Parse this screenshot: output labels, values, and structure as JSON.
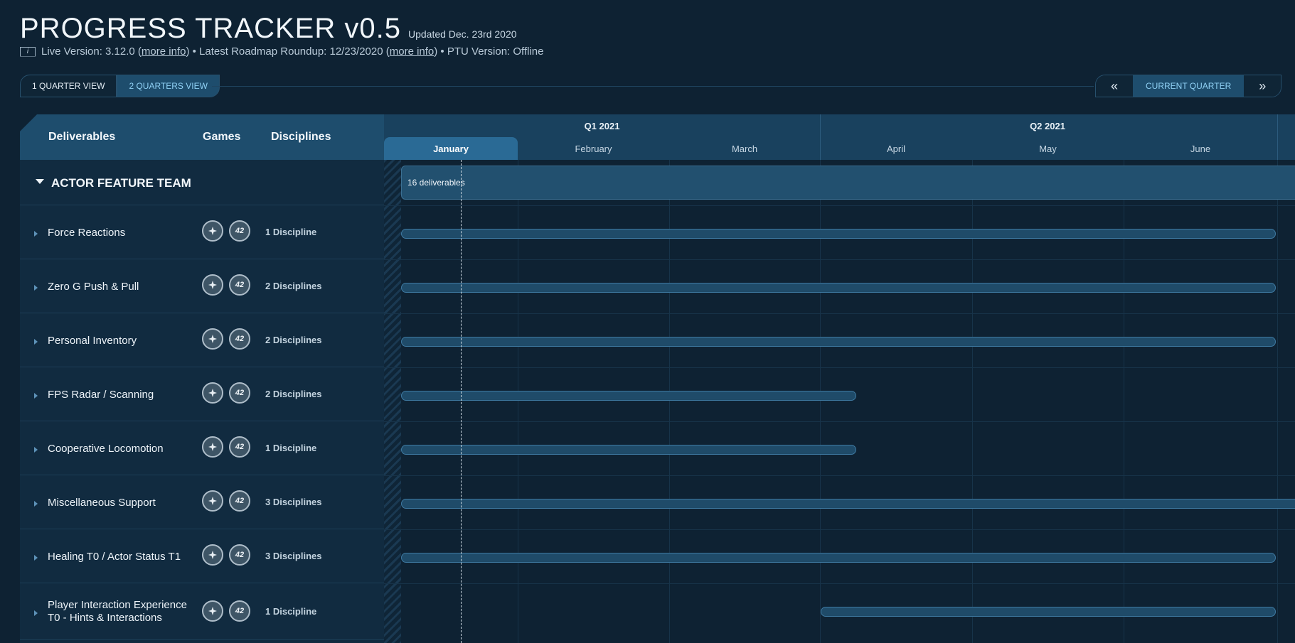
{
  "header": {
    "title": "PROGRESS TRACKER v0.5",
    "updated": "Updated Dec. 23rd 2020",
    "info_icon": "i",
    "live_version": "Live Version: 3.12.0 (",
    "more_info_1": "more info",
    "roadmap": ") • Latest Roadmap Roundup: 12/23/2020 (",
    "more_info_2": "more info",
    "ptu": ") • PTU Version: Offline"
  },
  "view_tabs": {
    "one_quarter": "1 QUARTER VIEW",
    "two_quarters": "2 QUARTERS VIEW"
  },
  "quarter_nav": {
    "prev": "«",
    "current": "CURRENT QUARTER",
    "next": "»"
  },
  "columns": {
    "deliverables": "Deliverables",
    "games": "Games",
    "disciplines": "Disciplines"
  },
  "timeline": {
    "quarters": [
      "Q1 2021",
      "Q2 2021"
    ],
    "months": [
      "January",
      "February",
      "March",
      "April",
      "May",
      "June"
    ]
  },
  "team": {
    "name": "ACTOR FEATURE TEAM",
    "deliverables_label": "16 deliverables"
  },
  "games_icons": {
    "star_citizen": "S",
    "squadron_42": "42"
  },
  "deliverables": [
    {
      "name": "Force Reactions",
      "disciplines": "1 Discipline"
    },
    {
      "name": "Zero G Push & Pull",
      "disciplines": "2 Disciplines"
    },
    {
      "name": "Personal Inventory",
      "disciplines": "2 Disciplines"
    },
    {
      "name": "FPS Radar / Scanning",
      "disciplines": "2 Disciplines"
    },
    {
      "name": "Cooperative Locomotion",
      "disciplines": "1 Discipline"
    },
    {
      "name": "Miscellaneous Support",
      "disciplines": "3 Disciplines"
    },
    {
      "name": "Healing T0 / Actor Status T1",
      "disciplines": "3 Disciplines"
    },
    {
      "name": "Player Interaction Experience T0 - Hints & Interactions",
      "disciplines": "1 Discipline"
    }
  ],
  "colors": {
    "accent": "#8fd0f4",
    "header_bg": "#1e4d6d",
    "bar": "#1f4b69",
    "page_bg": "#0e2233"
  }
}
